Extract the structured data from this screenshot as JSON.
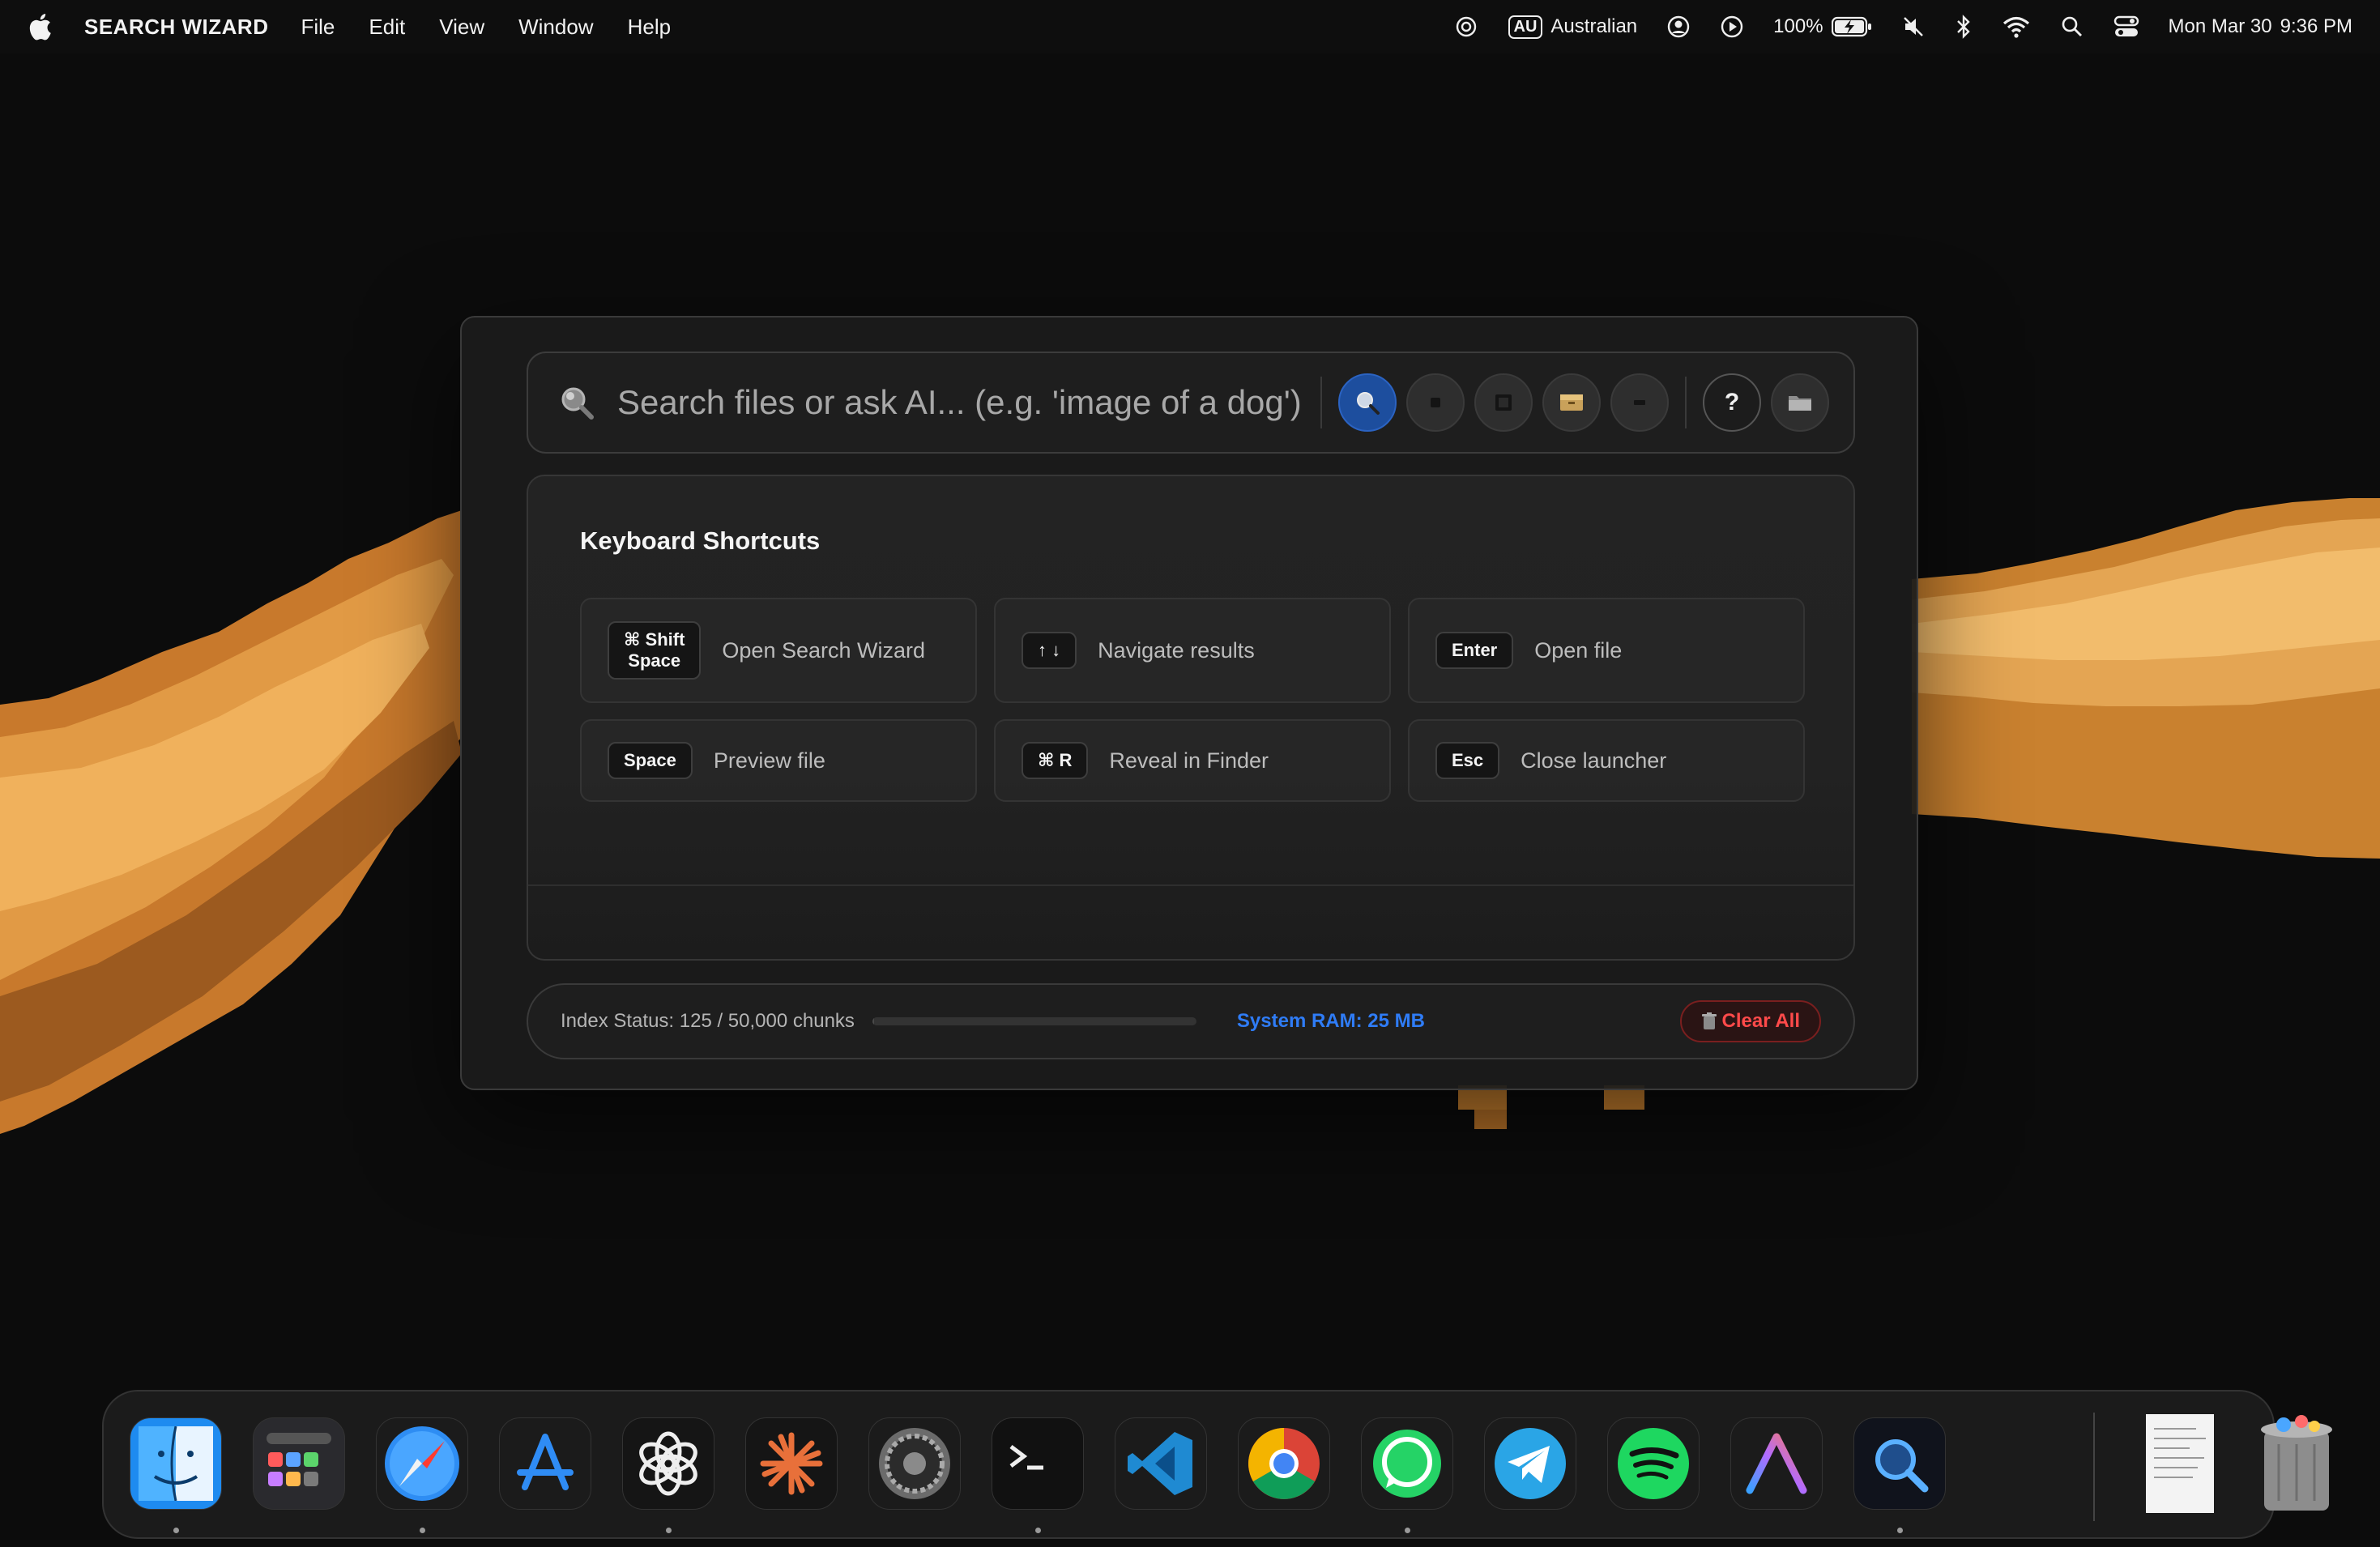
{
  "menubar": {
    "app_name": "SEARCH WIZARD",
    "menus": [
      "File",
      "Edit",
      "View",
      "Window",
      "Help"
    ],
    "input_source_code": "AU",
    "input_source_name": "Australian",
    "battery": "100%",
    "date": "Mon Mar 30",
    "time": "9:36 PM"
  },
  "launcher": {
    "search_placeholder": "Search files or ask AI... (e.g. 'image of a dog')",
    "modes": [
      {
        "name": "search-mode",
        "active": true
      },
      {
        "name": "mode-2",
        "active": false
      },
      {
        "name": "mode-3",
        "active": false
      },
      {
        "name": "mode-4",
        "active": false
      },
      {
        "name": "mode-5",
        "active": false
      }
    ],
    "help_label": "?",
    "panel_title": "Keyboard Shortcuts",
    "shortcuts": [
      {
        "keys": "⌘ Shift\nSpace",
        "label": "Open Search Wizard"
      },
      {
        "keys": "↑ ↓",
        "label": "Navigate results"
      },
      {
        "keys": "Enter",
        "label": "Open file"
      },
      {
        "keys": "Space",
        "label": "Preview file"
      },
      {
        "keys": "⌘ R",
        "label": "Reveal in Finder"
      },
      {
        "keys": "Esc",
        "label": "Close launcher"
      }
    ],
    "status": {
      "index_text": "Index Status: 125 / 50,000 chunks",
      "index_progress": 0.0025,
      "ram_text": "System RAM: 25 MB",
      "clear_label": "Clear All"
    }
  },
  "dock": {
    "apps": [
      {
        "name": "finder",
        "running": true
      },
      {
        "name": "launchpad",
        "running": false
      },
      {
        "name": "safari",
        "running": true
      },
      {
        "name": "app-store",
        "running": false
      },
      {
        "name": "chatgpt",
        "running": true
      },
      {
        "name": "claude",
        "running": false
      },
      {
        "name": "system-settings",
        "running": false
      },
      {
        "name": "terminal",
        "running": true
      },
      {
        "name": "vscode",
        "running": false
      },
      {
        "name": "chrome",
        "running": false
      },
      {
        "name": "whatsapp",
        "running": true
      },
      {
        "name": "telegram",
        "running": false
      },
      {
        "name": "spotify",
        "running": false
      },
      {
        "name": "arc-like",
        "running": true
      },
      {
        "name": "search-wizard",
        "running": true
      },
      {
        "name": "document",
        "running": false
      },
      {
        "name": "trash",
        "running": false
      }
    ]
  },
  "colors": {
    "accent_blue": "#2f7cf6",
    "danger_red": "#ff4a4a",
    "wallpaper_orange": "#d98a35"
  }
}
